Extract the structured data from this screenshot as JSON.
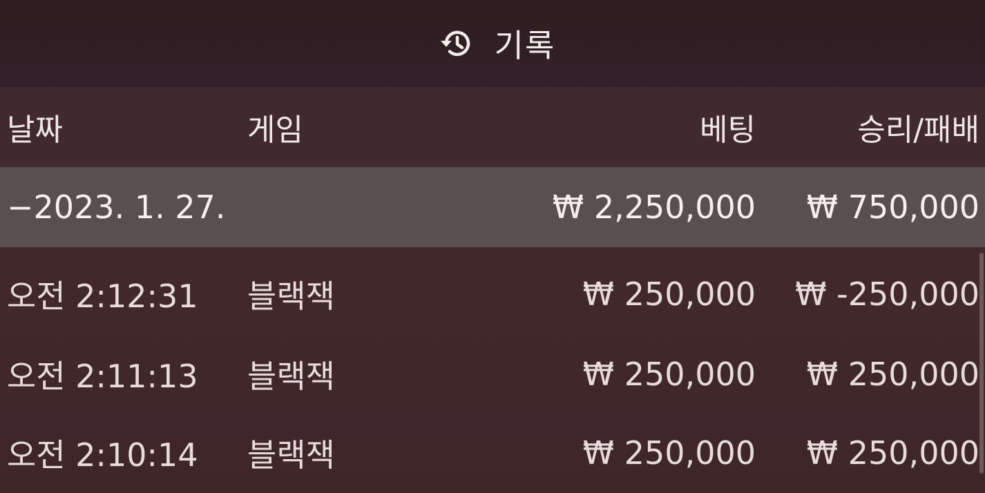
{
  "header": {
    "icon": "history-icon",
    "title": "기록"
  },
  "columns": {
    "date": "날짜",
    "game": "게임",
    "bet": "베팅",
    "result": "승리/패배"
  },
  "summary": {
    "date": "−2023. 1. 27.",
    "bet": "₩ 2,250,000",
    "result": "₩ 750,000"
  },
  "rows": [
    {
      "time": "오전 2:12:31",
      "game": "블랙잭",
      "bet": "₩ 250,000",
      "result": "₩ -250,000"
    },
    {
      "time": "오전 2:11:13",
      "game": "블랙잭",
      "bet": "₩ 250,000",
      "result": "₩ 250,000"
    },
    {
      "time": "오전 2:10:14",
      "game": "블랙잭",
      "bet": "₩ 250,000",
      "result": "₩ 250,000"
    }
  ],
  "colors": {
    "background": "#3d2528",
    "header_background": "#2e1d20",
    "summary_row": "#585050",
    "text": "#ece4e3"
  }
}
